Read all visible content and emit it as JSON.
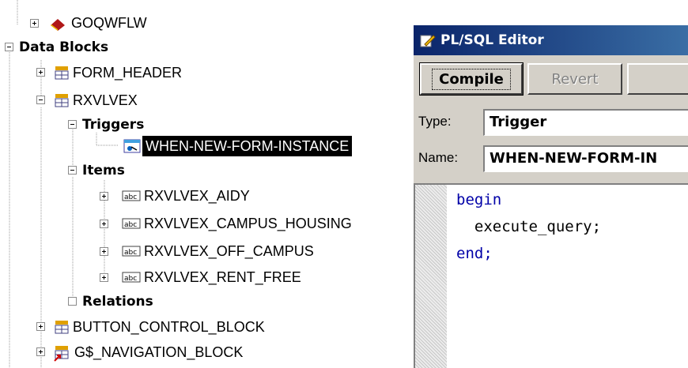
{
  "navigator": {
    "nodes": [
      {
        "label": "GOQWFLW"
      },
      {
        "label": "Data Blocks"
      },
      {
        "label": "FORM_HEADER"
      },
      {
        "label": "RXVLVEX"
      },
      {
        "label": "Triggers"
      },
      {
        "label": "WHEN-NEW-FORM-INSTANCE"
      },
      {
        "label": "Items"
      },
      {
        "label": "RXVLVEX_AIDY"
      },
      {
        "label": "RXVLVEX_CAMPUS_HOUSING"
      },
      {
        "label": "RXVLVEX_OFF_CAMPUS"
      },
      {
        "label": "RXVLVEX_RENT_FREE"
      },
      {
        "label": "Relations"
      },
      {
        "label": "BUTTON_CONTROL_BLOCK"
      },
      {
        "label": "G$_NAVIGATION_BLOCK"
      }
    ]
  },
  "editor": {
    "title": "PL/SQL Editor",
    "buttons": {
      "compile": "Compile",
      "revert": "Revert"
    },
    "type_label": "Type:",
    "type_value": "Trigger",
    "name_label": "Name:",
    "name_value": "WHEN-NEW-FORM-IN",
    "code": {
      "line1": "begin",
      "line2": "  execute_query;",
      "line3": "end;"
    }
  },
  "colors": {
    "selection": "#000000",
    "title_bar": "#0a246a",
    "keyword": "#0000a8"
  }
}
